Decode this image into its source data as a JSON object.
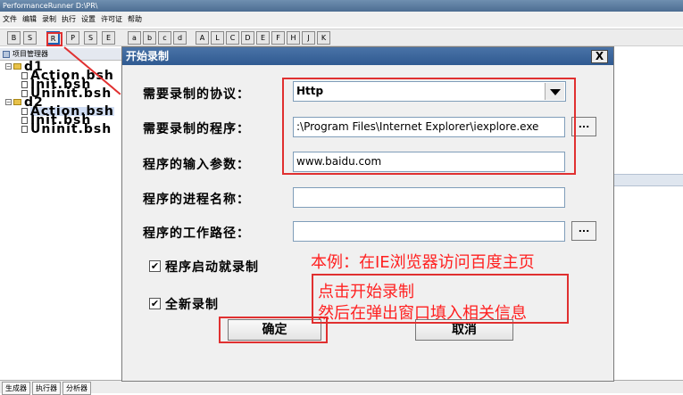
{
  "window": {
    "title": "PerformanceRunner  D:\\PR\\"
  },
  "menu": [
    "文件",
    "编辑",
    "录制",
    "执行",
    "设置",
    "许可证",
    "帮助"
  ],
  "toolbar": {
    "buttons": [
      "B",
      "S",
      "R",
      "P",
      "S",
      "E",
      "a",
      "b",
      "c",
      "d",
      "A",
      "L",
      "C",
      "D",
      "E",
      "F",
      "H",
      "J",
      "K"
    ]
  },
  "left_panel": {
    "header": "项目管理器",
    "tree": [
      {
        "label": "d1",
        "type": "folder",
        "level": 0
      },
      {
        "label": "Action.bsh",
        "type": "file",
        "level": 1
      },
      {
        "label": "Init.bsh",
        "type": "file",
        "level": 1
      },
      {
        "label": "Uninit.bsh",
        "type": "file",
        "level": 1
      },
      {
        "label": "d2",
        "type": "folder",
        "level": 0
      },
      {
        "label": "Action.bsh",
        "type": "file",
        "level": 1
      },
      {
        "label": "Init.bsh",
        "type": "file",
        "level": 1
      },
      {
        "label": "Uninit.bsh",
        "type": "file",
        "level": 1
      }
    ]
  },
  "bottom_tabs": [
    "生成器",
    "执行器",
    "分析器"
  ],
  "dialog": {
    "title": "开始录制",
    "close": "X",
    "protocol_label": "需要录制的协议：",
    "protocol_value": "Http",
    "program_label": "需要录制的程序：",
    "program_value": ":\\Program Files\\Internet Explorer\\iexplore.exe",
    "args_label": "程序的输入参数：",
    "args_value": "www.baidu.com",
    "process_label": "程序的进程名称：",
    "process_value": "",
    "workdir_label": "程序的工作路径：",
    "workdir_value": "",
    "browse": "...",
    "chk_start_record": {
      "label": "程序启动就录制",
      "checked": true
    },
    "chk_new_record": {
      "label": "全新录制",
      "checked": true
    },
    "ok": "确定",
    "cancel": "取消"
  },
  "annotations": {
    "line1": "本例：在IE浏览器访问百度主页",
    "line2": "点击开始录制",
    "line3": "然后在弹出窗口填入相关信息",
    "color": "#ff2020"
  }
}
